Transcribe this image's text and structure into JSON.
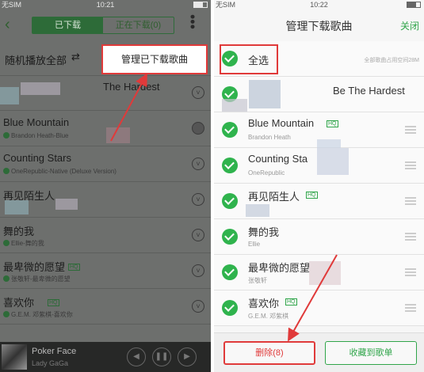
{
  "left": {
    "status": {
      "carrier": "无SIM",
      "time": "10:21"
    },
    "tabs": {
      "downloaded": "已下载",
      "downloading": "正在下载(0)"
    },
    "shuffle_label": "随机播放全部",
    "popup_label": "管理已下载歌曲",
    "songs": [
      {
        "title": "The Hardest",
        "sub": ""
      },
      {
        "title": "Blue Mountain",
        "sub": "Brandon Heath-Blue"
      },
      {
        "title": "Counting Stars",
        "sub": "OneRepublic-Native (Deluxe Version)"
      },
      {
        "title": "再见陌生人",
        "sub": ""
      },
      {
        "title": "舞的我",
        "sub": "Ellie-舞的我"
      },
      {
        "title": "最卑微的愿望",
        "sub": "张敬轩-最卑微的愿望"
      },
      {
        "title": "喜欢你",
        "sub": "G.E.M. 邓紫棋-喜欢你"
      }
    ],
    "hq_badge": "HQ",
    "player": {
      "song": "Poker Face",
      "artist": "Lady GaGa"
    }
  },
  "right": {
    "status": {
      "carrier": "无SIM",
      "time": "10:22"
    },
    "title": "管理下载歌曲",
    "close_label": "关闭",
    "select_all_label": "全选",
    "storage_text": "全部歌曲占用空间28M",
    "songs": [
      {
        "title": "Be The Hardest",
        "sub": ""
      },
      {
        "title": "Blue Mountain",
        "sub": "Brandon Heath"
      },
      {
        "title": "Counting Sta",
        "sub": "OneRepublic"
      },
      {
        "title": "再见陌生人",
        "sub": ""
      },
      {
        "title": "舞的我",
        "sub": "Ellie"
      },
      {
        "title": "最卑微的愿望",
        "sub": "张敬轩"
      },
      {
        "title": "喜欢你",
        "sub": "G.E.M. 邓紫棋"
      }
    ],
    "hq_badge": "HQ",
    "delete_label": "删除(8)",
    "collect_label": "收藏到歌单"
  },
  "colors": {
    "accent": "#30a54a",
    "highlight": "#e03a3a",
    "overlay": "#6d6f6d"
  }
}
